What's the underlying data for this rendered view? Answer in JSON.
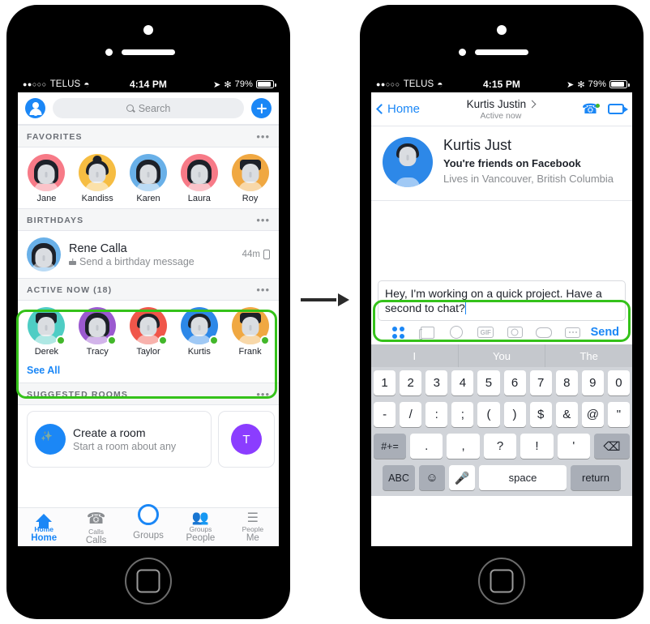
{
  "left_phone": {
    "status_bar": {
      "signal_dots": "●●○○○",
      "carrier": "TELUS",
      "wifi": "wifi-icon",
      "time": "4:14 PM",
      "location": "➤",
      "bluetooth": "✻",
      "battery_percent": "79%"
    },
    "top_bar": {
      "avatar": "profile-avatar",
      "search_placeholder": "Search",
      "add_label": "+"
    },
    "sections": [
      {
        "id": "favorites",
        "title": "FAVORITES",
        "menu": "•••"
      },
      {
        "id": "birthdays",
        "title": "BIRTHDAYS",
        "menu": "•••"
      },
      {
        "id": "active_now",
        "title": "ACTIVE NOW (18)",
        "menu": "•••"
      },
      {
        "id": "suggested_rooms",
        "title": "SUGGESTED ROOMS",
        "menu": "•••"
      }
    ],
    "favorites": [
      {
        "name": "Jane",
        "color": "#f77a87",
        "hair": "long"
      },
      {
        "name": "Kandiss",
        "color": "#f6bd42",
        "hair": "bun"
      },
      {
        "name": "Karen",
        "color": "#69b0e8",
        "hair": "long"
      },
      {
        "name": "Laura",
        "color": "#f77a87",
        "hair": "long"
      },
      {
        "name": "Roy",
        "color": "#f0a842",
        "hair": "flat"
      }
    ],
    "birthday": {
      "name": "Rene Calla",
      "action": "Send a birthday message",
      "time": "44m",
      "device": "mobile-icon",
      "color": "#69b0e8"
    },
    "active_now": [
      {
        "name": "Derek",
        "color": "#4ecdc4",
        "hair": "flat"
      },
      {
        "name": "Tracy",
        "color": "#9b59d0",
        "hair": "long"
      },
      {
        "name": "Taylor",
        "color": "#f0564a",
        "hair": "short"
      },
      {
        "name": "Kurtis",
        "color": "#2d88e8",
        "hair": "short"
      },
      {
        "name": "Frank",
        "color": "#f0a842",
        "hair": "flat"
      }
    ],
    "see_all": "See All",
    "rooms": {
      "title": "Create a room",
      "subtitle": "Start a room about any",
      "second_initial": "T"
    },
    "tabs": [
      {
        "small": "Home",
        "big": "Home",
        "icon": "home-icon",
        "active": true
      },
      {
        "small": "Calls",
        "big": "Calls",
        "icon": "phone-icon",
        "active": false
      },
      {
        "small": "",
        "big": "Groups",
        "icon": "circle-icon",
        "active": false
      },
      {
        "small": "Groups",
        "big": "People",
        "icon": "people-icon",
        "active": false
      },
      {
        "small": "People",
        "big": "Me",
        "icon": "list-icon",
        "active": false
      }
    ]
  },
  "right_phone": {
    "status_bar": {
      "signal_dots": "●●○○○",
      "carrier": "TELUS",
      "wifi": "wifi-icon",
      "time": "4:15 PM",
      "location": "➤",
      "bluetooth": "✻",
      "battery_percent": "79%"
    },
    "nav": {
      "back_label": "Home",
      "title": "Kurtis Justin",
      "status": "Active now",
      "call_icon": "phone-call-icon",
      "video_icon": "video-camera-icon"
    },
    "profile": {
      "name": "Kurtis Just",
      "line1": "You're friends on Facebook",
      "line2": "Lives in Vancouver, British Columbia",
      "color": "#2d88e8"
    },
    "composer": {
      "message": "Hey, I'm working on a quick project. Have a second to chat?",
      "send_label": "Send"
    },
    "composer_tools": [
      {
        "name": "apps-grid-icon"
      },
      {
        "name": "photos-icon"
      },
      {
        "name": "sticker-smiley-icon"
      },
      {
        "name": "gif-icon",
        "label": "GIF"
      },
      {
        "name": "camera-icon"
      },
      {
        "name": "games-icon"
      },
      {
        "name": "more-icon"
      }
    ],
    "keyboard": {
      "predictions": [
        "I",
        "You",
        "The"
      ],
      "row1": [
        "1",
        "2",
        "3",
        "4",
        "5",
        "6",
        "7",
        "8",
        "9",
        "0"
      ],
      "row2": [
        "-",
        "/",
        ":",
        ";",
        "(",
        ")",
        "$",
        "&",
        "@",
        "\""
      ],
      "row3_left": "#+=",
      "row3_mid": [
        ".",
        ",",
        "?",
        "!",
        "'"
      ],
      "row3_del": "delete-icon",
      "row4": {
        "abc": "ABC",
        "emoji": "emoji-icon",
        "mic": "microphone-icon",
        "space": "space",
        "return": "return"
      }
    }
  },
  "annotations": {
    "highlight_color": "#35c21a",
    "arrow_color": "#2b2b2b"
  }
}
